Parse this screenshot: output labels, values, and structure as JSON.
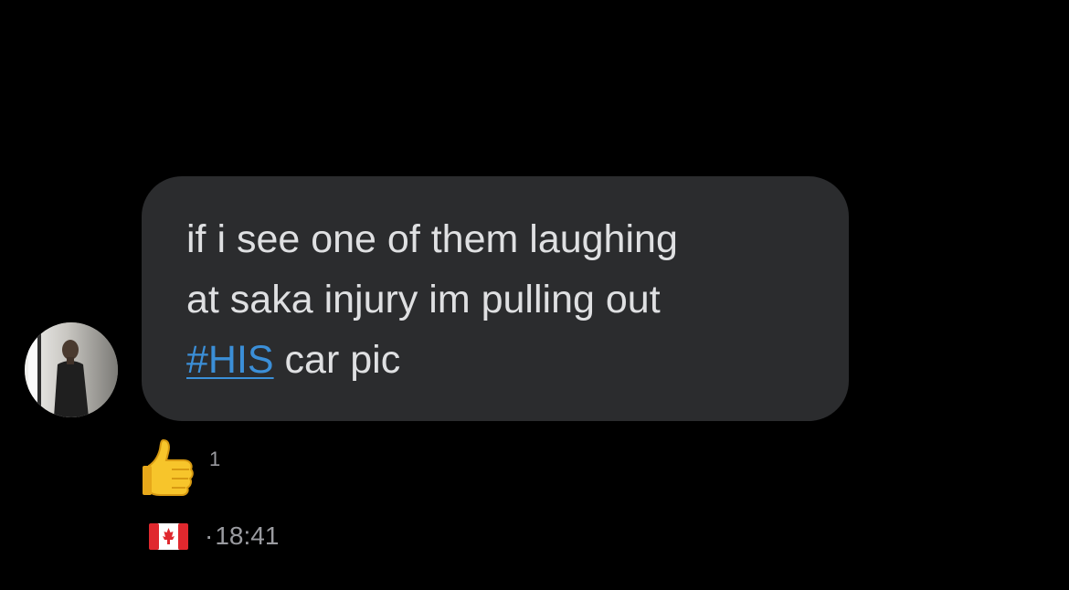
{
  "message": {
    "line1": "if i see one of them laughing",
    "line2": "at saka injury im pulling out",
    "hashtag": "#HIS",
    "line3_rest": " car pic"
  },
  "reaction": {
    "emoji": "thumbs-up-icon",
    "count": "1"
  },
  "meta": {
    "flag": "canada-flag-icon",
    "separator": "·",
    "time": "18:41"
  },
  "colors": {
    "background": "#000000",
    "bubble": "#2b2c2e",
    "text": "#dfe0e2",
    "link": "#3b8fd8",
    "muted": "#9a9ba0"
  }
}
